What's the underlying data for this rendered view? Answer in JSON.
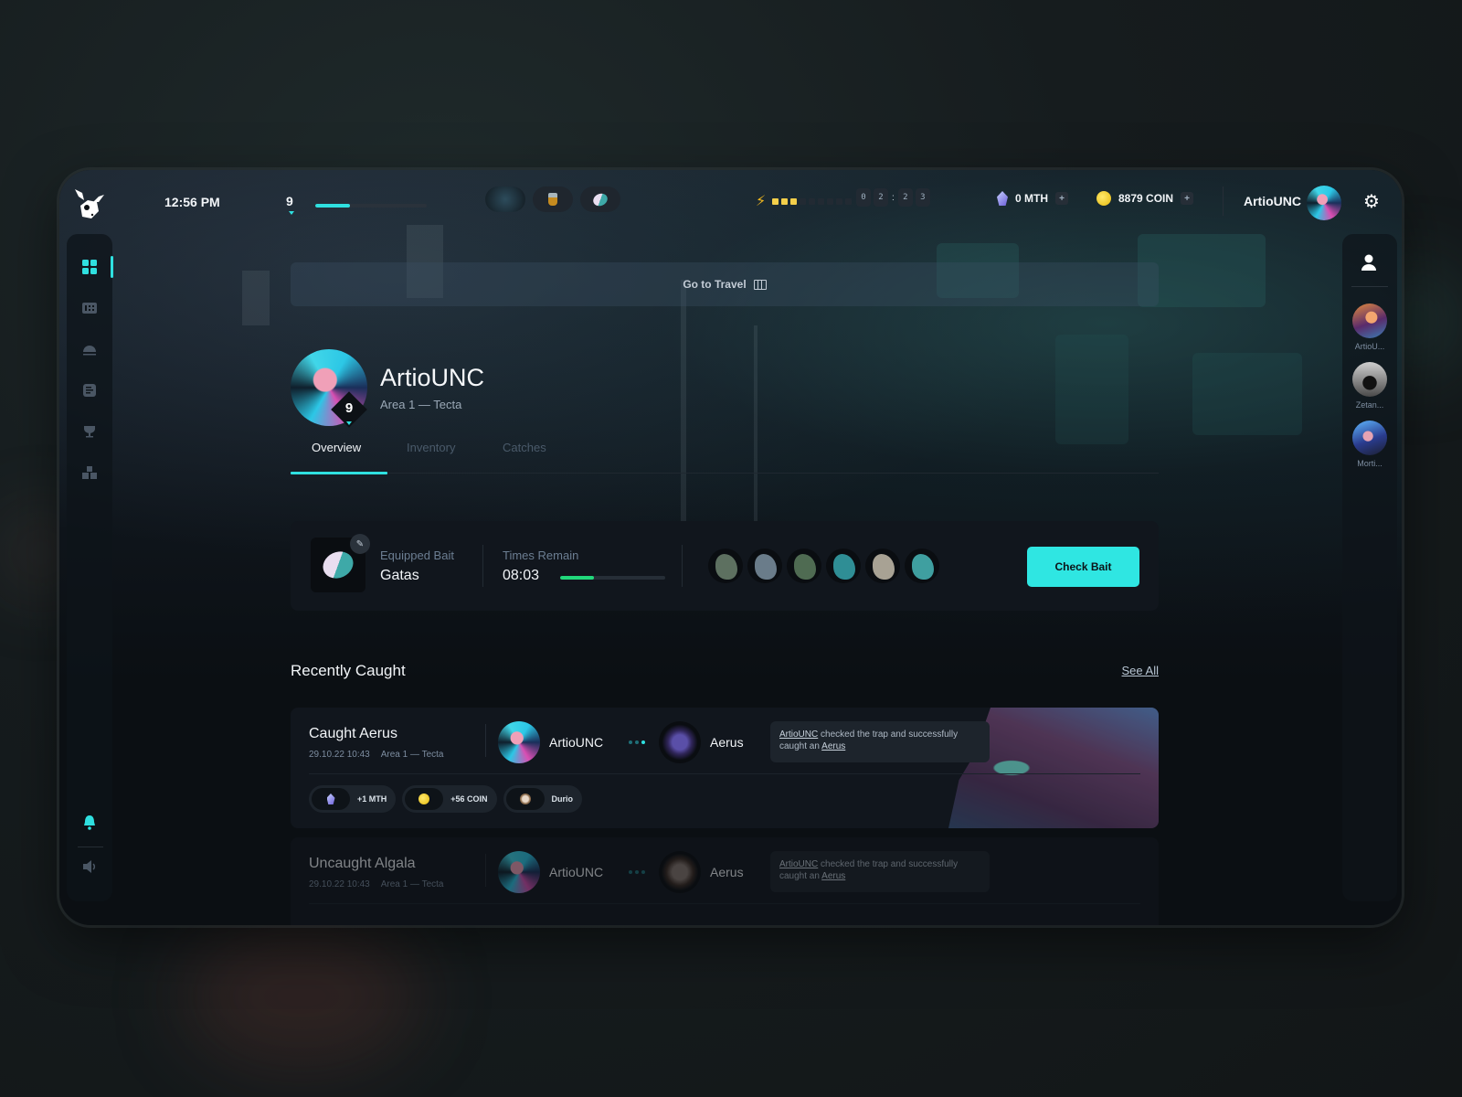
{
  "topbar": {
    "time": "12:56 PM",
    "level": "9",
    "xp_progress": 0.31,
    "quick_items": [
      {
        "name": "map-item"
      },
      {
        "name": "jar-item"
      },
      {
        "name": "bait-item"
      }
    ],
    "energy": {
      "filled": 3,
      "total": 9
    },
    "timer_digits": [
      "0",
      "2",
      "2",
      "3"
    ],
    "timer_separator": ":",
    "mth": "0 MTH",
    "coin": "8879 COIN",
    "plus_label": "+",
    "username": "ArtioUNC"
  },
  "nav": {
    "items": [
      "dashboard",
      "cards",
      "dome",
      "notes",
      "trophy",
      "boxes"
    ],
    "active": "dashboard"
  },
  "friends": [
    {
      "name": "ArtioU..."
    },
    {
      "name": "Zetan..."
    },
    {
      "name": "Morti..."
    }
  ],
  "travel": {
    "label": "Go to Travel"
  },
  "profile": {
    "name": "ArtioUNC",
    "area": "Area 1 — Tecta",
    "level": "9"
  },
  "tabs": [
    {
      "label": "Overview",
      "active": true
    },
    {
      "label": "Inventory",
      "active": false
    },
    {
      "label": "Catches",
      "active": false
    }
  ],
  "bait": {
    "label": "Equipped Bait",
    "name": "Gatas",
    "times_label": "Times Remain",
    "times_value": "08:03",
    "times_progress": 0.32,
    "check_label": "Check Bait",
    "creatures": [
      "#5d7060",
      "#6a7c8a",
      "#4f6b52",
      "#2f8e95",
      "#a8a294",
      "#3f9fa0"
    ]
  },
  "recent": {
    "title": "Recently Caught",
    "see_all": "See All",
    "items": [
      {
        "title": "Caught Aerus",
        "date": "29.10.22 10:43",
        "area": "Area 1 — Tecta",
        "player": "ArtioUNC",
        "creature": "Aerus",
        "msg_user": "ArtioUNC",
        "msg_mid": " checked the trap and successfully caught an ",
        "msg_creature": "Aerus",
        "rewards": [
          {
            "label": "+1 MTH",
            "icon": "gem-icon"
          },
          {
            "label": "+56 COIN",
            "icon": "coin-icon"
          },
          {
            "label": "Durio",
            "icon": "durio-icon"
          }
        ]
      },
      {
        "title": "Uncaught Algala",
        "date": "29.10.22 10:43",
        "area": "Area 1 — Tecta",
        "player": "ArtioUNC",
        "creature": "Aerus",
        "msg_user": "ArtioUNC",
        "msg_mid": " checked the trap and successfully caught an ",
        "msg_creature": "Aerus"
      }
    ]
  }
}
